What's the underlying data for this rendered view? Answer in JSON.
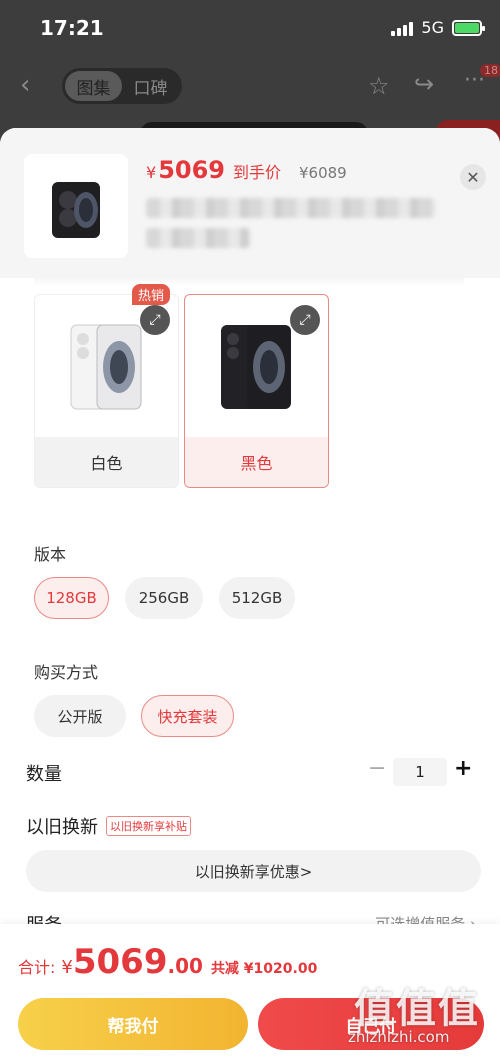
{
  "status_bar": {
    "time": "17:21",
    "network": "5G"
  },
  "bg_nav": {
    "tabs": [
      "图集",
      "口碑"
    ],
    "badge": "18"
  },
  "header": {
    "price_currency": "¥",
    "price": "5069",
    "price_tag": "到手价",
    "original_price": "¥6089"
  },
  "colors": {
    "hot_badge": "热销",
    "items": [
      {
        "label": "白色",
        "selected": false
      },
      {
        "label": "黑色",
        "selected": true
      }
    ]
  },
  "version": {
    "title": "版本",
    "options": [
      {
        "label": "128GB",
        "selected": true
      },
      {
        "label": "256GB",
        "selected": false
      },
      {
        "label": "512GB",
        "selected": false
      }
    ]
  },
  "purchase": {
    "title": "购买方式",
    "options": [
      {
        "label": "公开版",
        "selected": false
      },
      {
        "label": "快充套装",
        "selected": true
      }
    ]
  },
  "quantity": {
    "label": "数量",
    "value": "1",
    "minus": "−",
    "plus": "+"
  },
  "trade_in": {
    "title": "以旧换新",
    "badge": "以旧换新享补贴",
    "button": "以旧换新享优惠>"
  },
  "service": {
    "title": "服务",
    "hint": "可选增值服务 ›"
  },
  "bottom": {
    "total_label": "合计:",
    "total_currency": "¥",
    "total_int": "5069",
    "total_dec": ".00",
    "saving": "共减 ¥1020.00",
    "help_button": "帮我付",
    "pay_button": "自己付"
  },
  "watermark": {
    "logo": "值值值",
    "url": "zhizhizhi.com"
  },
  "accent_color": "#e4393c"
}
